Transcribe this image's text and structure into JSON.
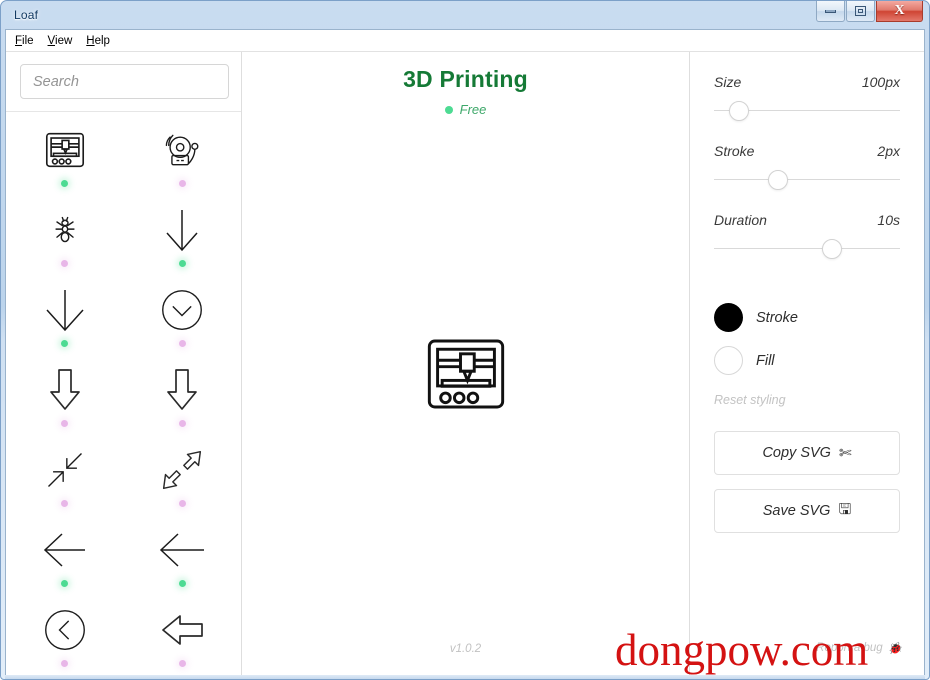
{
  "window": {
    "title": "Loaf",
    "buttons": {
      "minimize": "minimize",
      "maximize": "maximize",
      "close": "X"
    }
  },
  "menubar": {
    "items": [
      {
        "mnemonic": "F",
        "rest": "ile"
      },
      {
        "mnemonic": "V",
        "rest": "iew"
      },
      {
        "mnemonic": "H",
        "rest": "elp"
      }
    ]
  },
  "sidebar": {
    "search": {
      "value": "",
      "placeholder": "Search"
    },
    "icons": [
      {
        "name": "3d-printer",
        "status": "free"
      },
      {
        "name": "alarm-bell",
        "status": "pro"
      },
      {
        "name": "ant",
        "status": "pro"
      },
      {
        "name": "arrow-down-thin",
        "status": "free"
      },
      {
        "name": "arrow-down-wide",
        "status": "free"
      },
      {
        "name": "arrow-down-circle",
        "status": "pro"
      },
      {
        "name": "arrow-down-block",
        "status": "pro"
      },
      {
        "name": "arrow-down-block-alt",
        "status": "pro"
      },
      {
        "name": "arrows-collapse-diagonal",
        "status": "pro"
      },
      {
        "name": "arrows-expand-diagonal-block",
        "status": "pro"
      },
      {
        "name": "arrow-left-thin",
        "status": "free"
      },
      {
        "name": "arrow-left-thin-long",
        "status": "free"
      },
      {
        "name": "arrow-left-circle",
        "status": "pro"
      },
      {
        "name": "arrow-left-block",
        "status": "pro"
      }
    ]
  },
  "preview": {
    "title": "3D Printing",
    "badge": "Free",
    "icon_name": "3d-printer",
    "version": "v1.0.2",
    "title_color": "#157a36",
    "badge_color": "#3ea86a",
    "badge_dot_color": "#4ddb93"
  },
  "controls": {
    "sliders": [
      {
        "label": "Size",
        "value": "100px",
        "percent": 8
      },
      {
        "label": "Stroke",
        "value": "2px",
        "percent": 29
      },
      {
        "label": "Duration",
        "value": "10s",
        "percent": 58
      }
    ],
    "swatches": [
      {
        "label": "Stroke",
        "color": "#000000",
        "selected": true
      },
      {
        "label": "Fill",
        "color": "#ffffff",
        "selected": false
      }
    ],
    "reset_label": "Reset styling",
    "buttons": [
      {
        "label": "Copy SVG",
        "icon": "✄",
        "icon_name": "scissors-icon"
      },
      {
        "label": "Save SVG",
        "icon": "🖫",
        "icon_name": "floppy-disk-icon"
      }
    ],
    "report_label": "Report a bug",
    "report_icon": "🐞"
  },
  "watermark": {
    "text": "dongpow.com",
    "color": "#d41212"
  }
}
